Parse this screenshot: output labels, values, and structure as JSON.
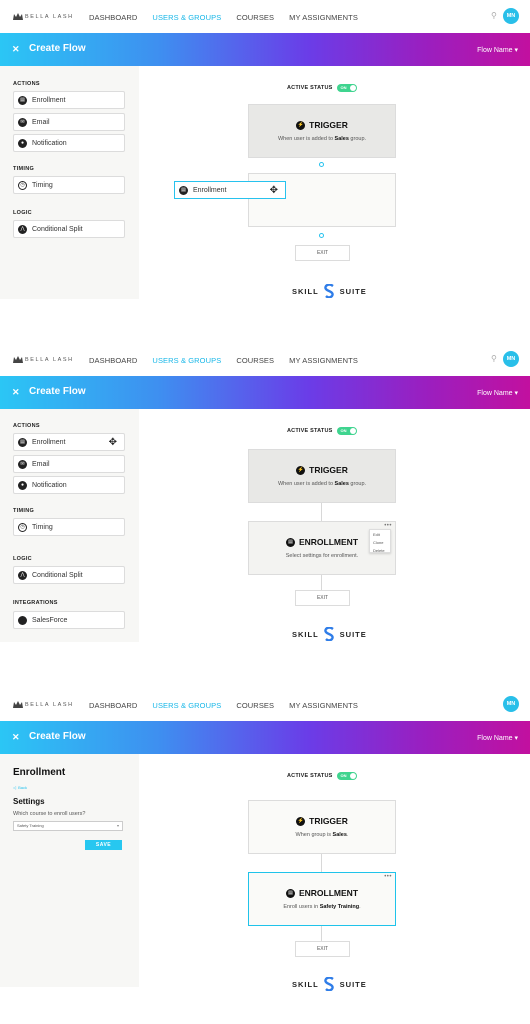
{
  "app": {
    "logo_text": "BELLA LASH",
    "avatar_initials": "MN"
  },
  "nav": {
    "dashboard": "DASHBOARD",
    "users_groups": "USERS & GROUPS",
    "courses": "COURSES",
    "my_assignments": "MY ASSIGNMENTS"
  },
  "header": {
    "title": "Create Flow",
    "flow_name": "Flow Name ▾"
  },
  "panel": {
    "actions": "ACTIONS",
    "timing": "TIMING",
    "logic": "LOGIC",
    "integrations": "INTEGRATIONS",
    "enrollment": "Enrollment",
    "email": "Email",
    "notification": "Notification",
    "timing_item": "Timing",
    "conditional_split": "Conditional Split",
    "salesforce": "SalesForce"
  },
  "canvas": {
    "active_status": "ACTIVE STATUS",
    "toggle_on": "ON",
    "exit": "EXIT",
    "trigger_title": "TRIGGER",
    "trigger_desc_1_pre": "When user is added to ",
    "trigger_desc_1_group": "Sales",
    "trigger_desc_1_post": " group.",
    "trigger_desc_3_pre": "When group is ",
    "trigger_desc_3_group": "Sales",
    "trigger_desc_3_post": ".",
    "enrollment_title": "ENROLLMENT",
    "enrollment_desc_2": "Select settings for enrollment.",
    "enrollment_desc_3_pre": "Enroll users in ",
    "enrollment_desc_3_course": "Safety Training",
    "enrollment_desc_3_post": ".",
    "menu_dots": "•••",
    "ctx_edit": "Edit",
    "ctx_clone": "Clone",
    "ctx_delete": "Delete",
    "drag_label": "Enrollment"
  },
  "settings": {
    "title": "Enrollment",
    "back": "Back",
    "subtitle": "Settings",
    "question": "Which course to enroll users?",
    "selected_course": "Safety Training",
    "save": "SAVE"
  },
  "brand": {
    "left": "SKILL",
    "right": "SUITE"
  },
  "colors": {
    "accent": "#27c2ee",
    "toggle": "#3fd48f"
  },
  "icons": {
    "close": "✕",
    "search": "⚲",
    "move": "✥",
    "bolt": "⚡",
    "enroll": "▤",
    "email": "✉",
    "bell": "●",
    "clock": "◷",
    "split": "⋀"
  }
}
